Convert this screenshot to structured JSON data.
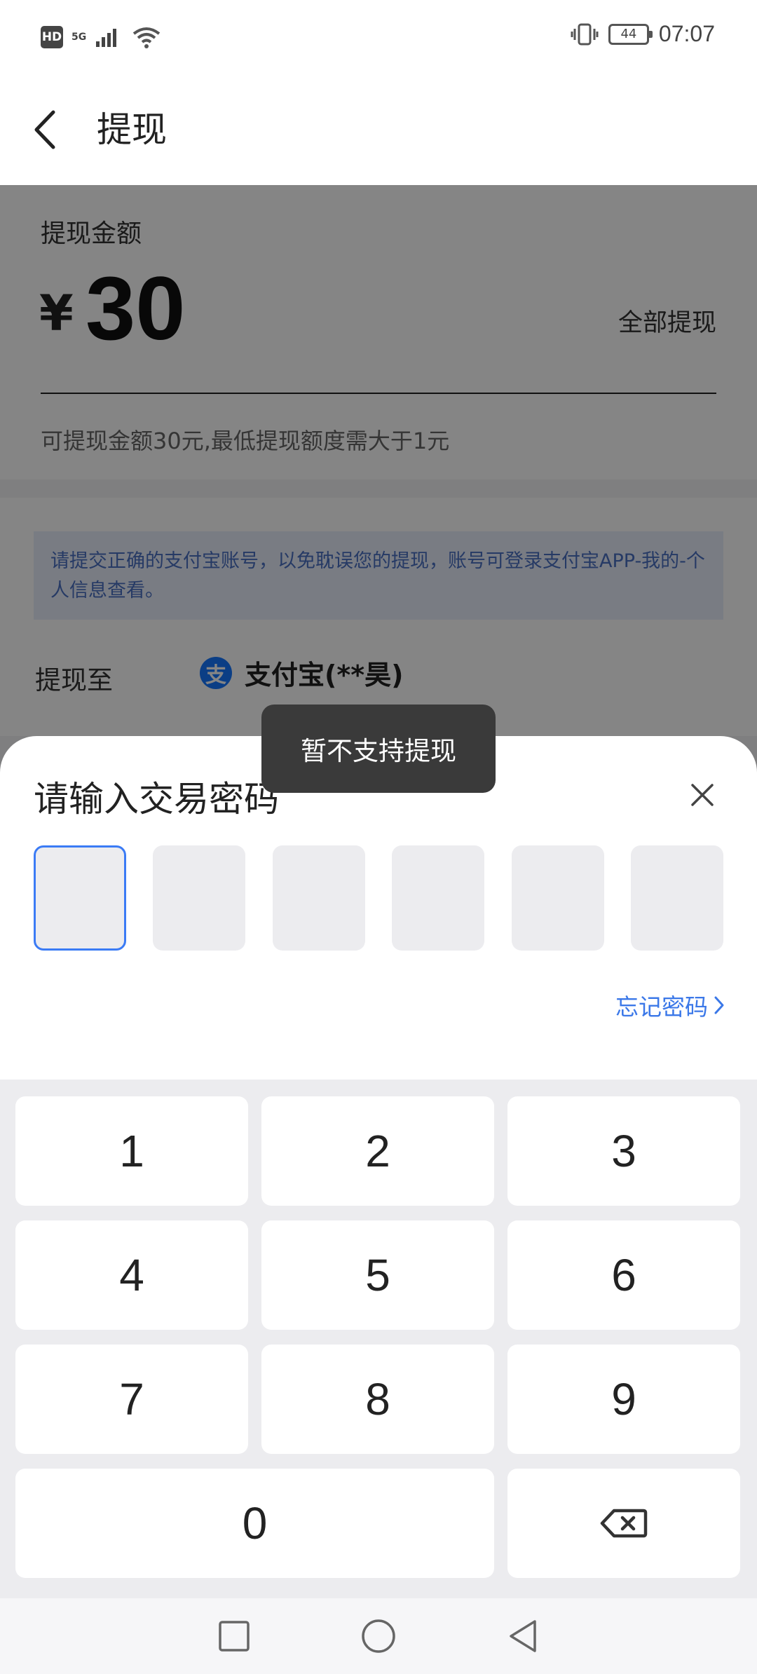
{
  "status_bar": {
    "hd": "HD",
    "network": "5G",
    "battery": "44",
    "time": "07:07",
    "icons": [
      "signal-icon",
      "wifi-icon",
      "vibrate-icon",
      "battery-icon"
    ]
  },
  "header": {
    "title": "提现",
    "back_icon": "back-chevron-icon"
  },
  "amount": {
    "label": "提现金额",
    "currency": "¥",
    "value": "30",
    "withdraw_all": "全部提现",
    "hint": "可提现金额30元,最低提现额度需大于1元"
  },
  "info": {
    "notice": "请提交正确的支付宝账号，以免耽误您的提现，账号可登录支付宝APP-我的-个人信息查看。",
    "dest_label": "提现至",
    "dest_icon_glyph": "支",
    "dest_account": "支付宝(**昊)"
  },
  "toast": {
    "message": "暂不支持提现"
  },
  "password_sheet": {
    "title": "请输入交易密码",
    "pin_length": 6,
    "forgot_label": "忘记密码",
    "close_icon": "close-icon"
  },
  "keypad": {
    "keys": [
      "1",
      "2",
      "3",
      "4",
      "5",
      "6",
      "7",
      "8",
      "9",
      "0"
    ],
    "backspace_icon": "backspace-icon"
  },
  "nav_bar": {
    "icons": [
      "recent-apps-icon",
      "home-icon",
      "back-icon"
    ]
  },
  "colors": {
    "accent": "#3b7bf5",
    "alipay": "#1677ff",
    "notice_text": "#4a6fc2",
    "notice_bg": "#e8eefb",
    "overlay": "rgba(0,0,0,0.48)"
  }
}
